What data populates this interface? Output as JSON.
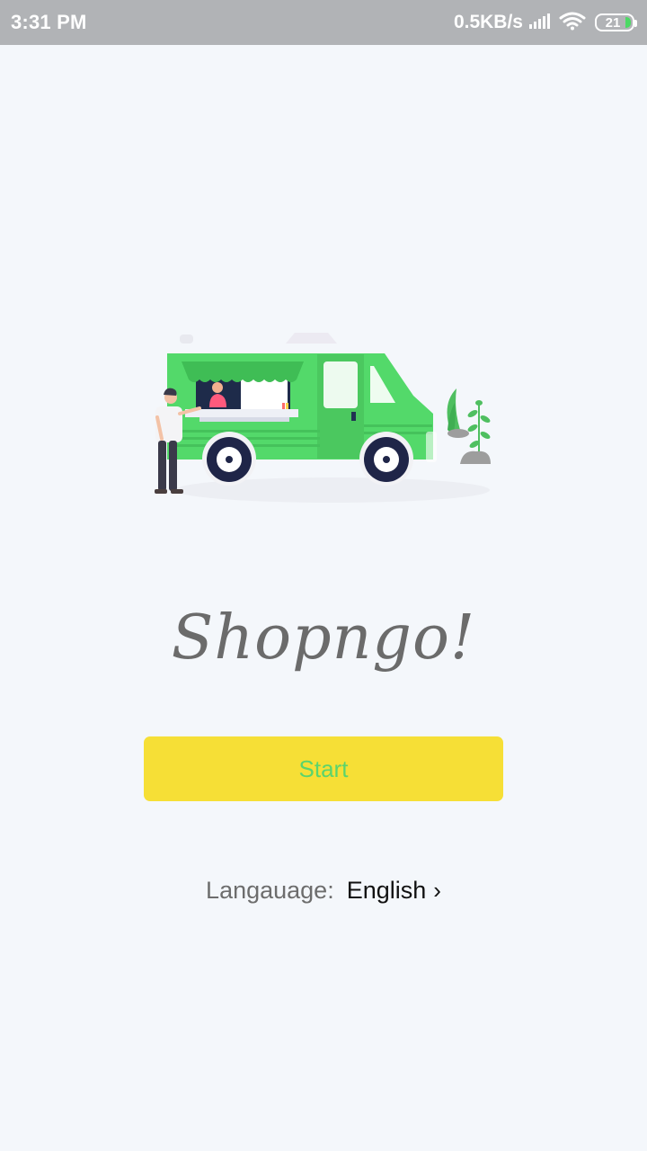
{
  "status_bar": {
    "time": "3:31 PM",
    "net_speed": "0.5KB/s",
    "battery_level": "21",
    "icons": [
      "signal-icon",
      "wifi-icon",
      "battery-icon"
    ]
  },
  "illustration": {
    "icon": "food-truck-illustration"
  },
  "brand": {
    "title": "Shopngo!"
  },
  "start": {
    "label": "Start"
  },
  "language": {
    "label": "Langauage:",
    "value": "English",
    "chevron": "›"
  },
  "colors": {
    "background": "#f4f7fb",
    "status_bar": "#b1b3b6",
    "button": "#f6df36",
    "button_text": "#5bd46c",
    "truck": "#53d96a"
  }
}
